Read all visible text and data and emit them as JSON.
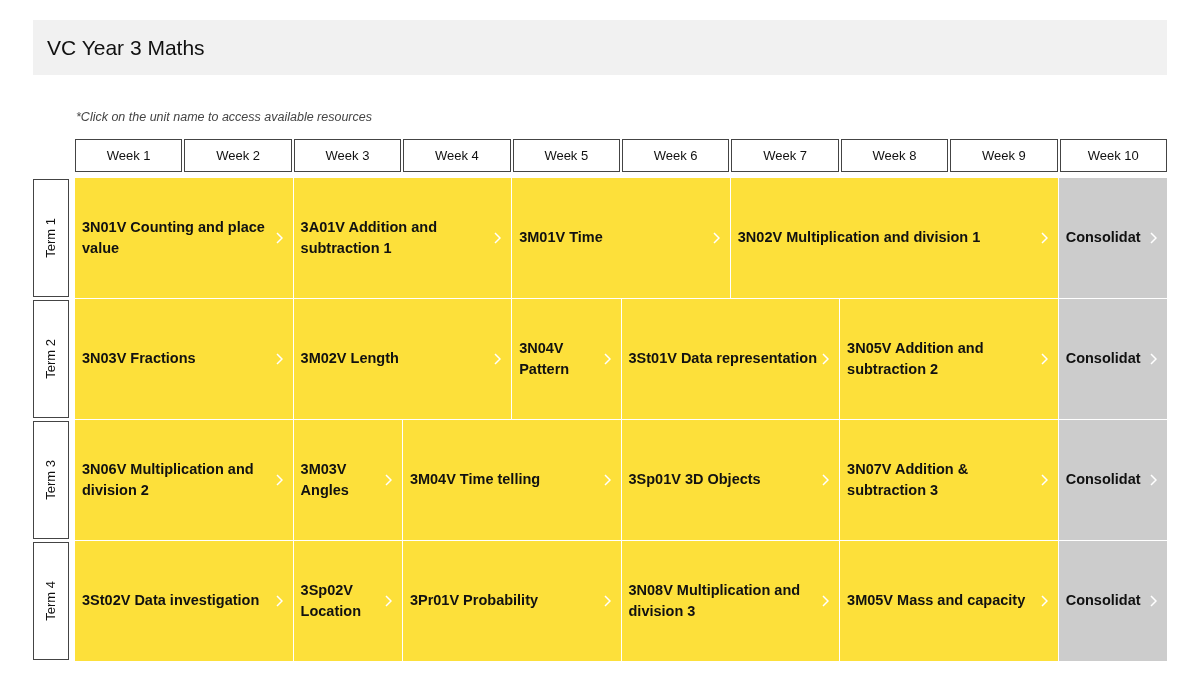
{
  "title": "VC Year 3 Maths",
  "note": "*Click on the unit name to access available resources",
  "weeks": [
    "Week 1",
    "Week 2",
    "Week 3",
    "Week 4",
    "Week 5",
    "Week 6",
    "Week 7",
    "Week 8",
    "Week 9",
    "Week 10"
  ],
  "terms": [
    {
      "label": "Term 1",
      "units": [
        {
          "kind": "unit",
          "label": "3N01V Counting and place value"
        },
        {
          "kind": "unit",
          "label": "3A01V Addition and subtraction 1"
        },
        {
          "kind": "unit",
          "label": "3M01V Time"
        },
        {
          "kind": "unit",
          "label": "3N02V Multiplication and division 1"
        },
        {
          "kind": "consolidation",
          "label": "Consolidat"
        }
      ]
    },
    {
      "label": "Term 2",
      "units": [
        {
          "kind": "unit",
          "label": "3N03V Fractions"
        },
        {
          "kind": "unit",
          "label": "3M02V Length"
        },
        {
          "kind": "unit",
          "label": "3N04V Pattern"
        },
        {
          "kind": "unit",
          "label": "3St01V Data representation"
        },
        {
          "kind": "unit",
          "label": "3N05V Addition and subtraction 2"
        },
        {
          "kind": "consolidation",
          "label": "Consolidat"
        }
      ]
    },
    {
      "label": "Term 3",
      "units": [
        {
          "kind": "unit",
          "label": "3N06V Multiplication and division 2"
        },
        {
          "kind": "unit",
          "label": "3M03V Angles"
        },
        {
          "kind": "unit",
          "label": "3M04V Time telling"
        },
        {
          "kind": "unit",
          "label": "3Sp01V 3D Objects"
        },
        {
          "kind": "unit",
          "label": "3N07V Addition & subtraction 3"
        },
        {
          "kind": "consolidation",
          "label": "Consolidat"
        }
      ]
    },
    {
      "label": "Term 4",
      "units": [
        {
          "kind": "unit",
          "label": "3St02V Data investigation"
        },
        {
          "kind": "unit",
          "label": "3Sp02V Location"
        },
        {
          "kind": "unit",
          "label": "3Pr01V Probability"
        },
        {
          "kind": "unit",
          "label": "3N08V Multiplication and division 3"
        },
        {
          "kind": "unit",
          "label": "3M05V Mass and capacity"
        },
        {
          "kind": "consolidation",
          "label": "Consolidat"
        }
      ]
    }
  ]
}
